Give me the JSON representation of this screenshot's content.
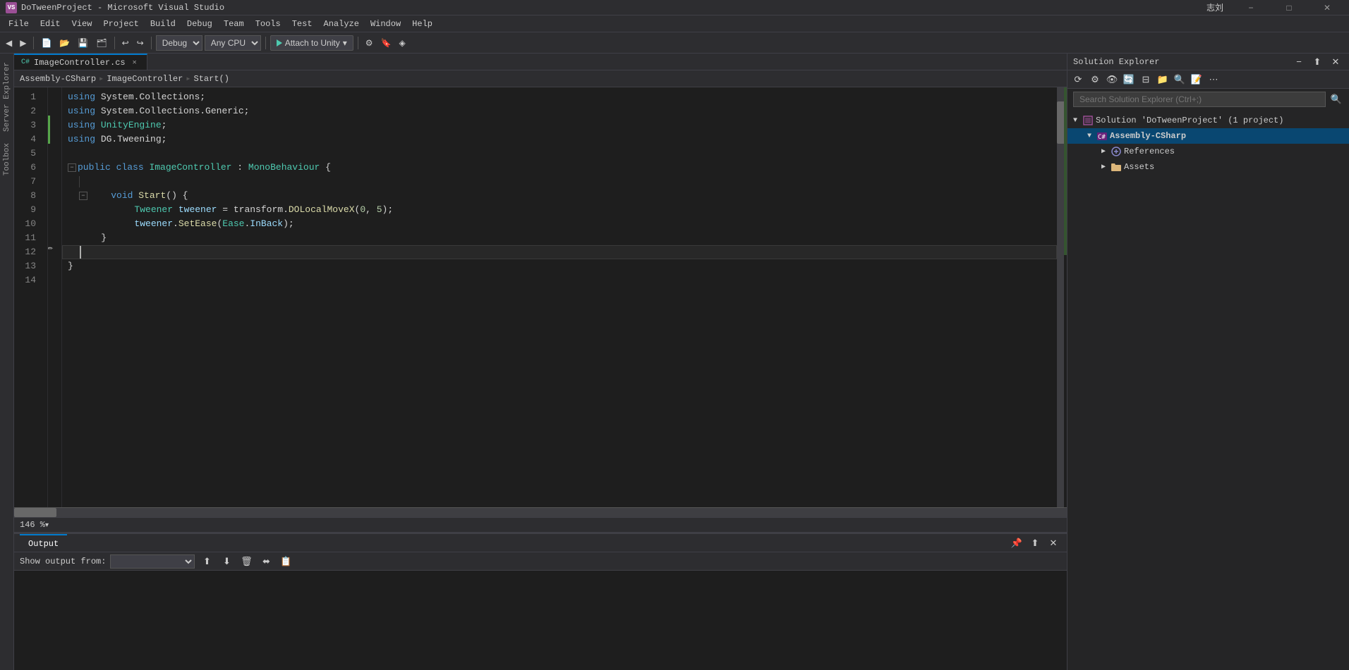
{
  "titlebar": {
    "icon_label": "VS",
    "title": "DoTweenProject - Microsoft Visual Studio",
    "user": "志刘",
    "buttons": {
      "minimize": "−",
      "maximize": "□",
      "close": "✕"
    }
  },
  "menubar": {
    "items": [
      "File",
      "Edit",
      "View",
      "Project",
      "Build",
      "Debug",
      "Team",
      "Tools",
      "Test",
      "Analyze",
      "Window",
      "Help"
    ]
  },
  "toolbar": {
    "debug_config": "Debug",
    "platform": "Any CPU",
    "attach_label": "Attach to Unity",
    "zoom_label": "146 %"
  },
  "tabs": {
    "active": "ImageController.cs",
    "items": [
      "ImageController.cs"
    ]
  },
  "breadcrumb": {
    "assembly": "Assembly-CSharp",
    "class": "ImageController",
    "method": "Start()"
  },
  "code": {
    "lines": [
      {
        "num": 1,
        "indent": 0,
        "has_green": false,
        "active": false,
        "content": "using System.Collections;"
      },
      {
        "num": 2,
        "indent": 0,
        "has_green": false,
        "active": false,
        "content": "using System.Collections.Generic;"
      },
      {
        "num": 3,
        "indent": 0,
        "has_green": true,
        "active": false,
        "content": "using UnityEngine;"
      },
      {
        "num": 4,
        "indent": 0,
        "has_green": true,
        "active": false,
        "content": "using DG.Tweening;"
      },
      {
        "num": 5,
        "indent": 0,
        "has_green": false,
        "active": false,
        "content": ""
      },
      {
        "num": 6,
        "indent": 0,
        "has_green": false,
        "active": false,
        "content": "public class ImageController : MonoBehaviour {"
      },
      {
        "num": 7,
        "indent": 0,
        "has_green": false,
        "active": false,
        "content": ""
      },
      {
        "num": 8,
        "indent": 1,
        "has_green": false,
        "active": false,
        "content": "    void Start() {"
      },
      {
        "num": 9,
        "indent": 2,
        "has_green": false,
        "active": false,
        "content": "        Tweener tweener = transform.DOLocalMoveX(0, 5);"
      },
      {
        "num": 10,
        "indent": 2,
        "has_green": false,
        "active": false,
        "content": "        tweener.SetEase(Ease.InBack);"
      },
      {
        "num": 11,
        "indent": 1,
        "has_green": false,
        "active": false,
        "content": "    }"
      },
      {
        "num": 12,
        "indent": 0,
        "has_green": false,
        "active": true,
        "content": ""
      },
      {
        "num": 13,
        "indent": 0,
        "has_green": false,
        "active": false,
        "content": "}"
      },
      {
        "num": 14,
        "indent": 0,
        "has_green": false,
        "active": false,
        "content": ""
      }
    ]
  },
  "solution_explorer": {
    "title": "Solution Explorer",
    "search_placeholder": "Search Solution Explorer (Ctrl+;)",
    "tree": {
      "solution_label": "Solution 'DoTweenProject' (1 project)",
      "project_label": "Assembly-CSharp",
      "references_label": "References",
      "assets_label": "Assets"
    }
  },
  "output_panel": {
    "title": "Output",
    "show_output_from_label": "Show output from:",
    "select_placeholder": ""
  },
  "statusbar": {
    "zoom": "146 %"
  }
}
